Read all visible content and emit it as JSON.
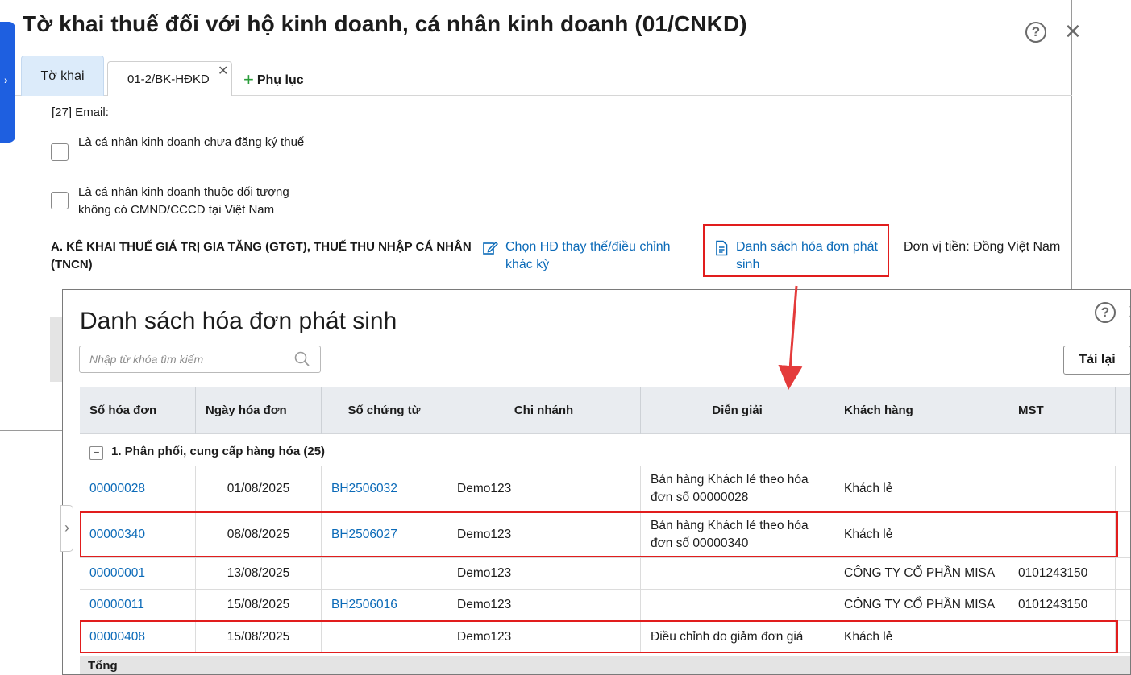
{
  "background_window": {
    "title": "Tờ khai thuế đối với hộ kinh doanh, cá nhân kinh doanh (01/CNKD)",
    "help_icon": "?",
    "close_icon": "✕",
    "tabs": [
      {
        "label": "Tờ khai",
        "active": true
      },
      {
        "label": "01-2/BK-HĐKD",
        "closable": true
      }
    ],
    "add_tab_label": "Phụ lục",
    "email_label": "[27] Email:",
    "checkboxes": [
      {
        "label": "Là cá nhân kinh doanh chưa đăng ký thuế",
        "checked": false
      },
      {
        "label": "Là cá nhân kinh doanh thuộc đối tượng không có CMND/CCCD tại Việt Nam",
        "checked": false
      }
    ],
    "section_a_title": "A. KÊ KHAI THUẾ GIÁ TRỊ GIA TĂNG (GTGT), THUẾ THU NHẬP CÁ NHÂN (TNCN)",
    "link_choose": "Chọn HĐ thay thế/điều chỉnh khác kỳ",
    "link_invoice_list": "Danh sách hóa đơn phát sinh",
    "currency_unit": "Đơn vị tiền: Đồng Việt Nam"
  },
  "dialog": {
    "title": "Danh sách hóa đơn phát sinh",
    "search_placeholder": "Nhập từ khóa tìm kiếm",
    "reload_button": "Tải lại",
    "columns": [
      "Số hóa đơn",
      "Ngày hóa đơn",
      "Số chứng từ",
      "Chi nhánh",
      "Diễn giải",
      "Khách hàng",
      "MST"
    ],
    "group": {
      "label": "1. Phân phối, cung cấp hàng hóa (25)",
      "expanded": true
    },
    "rows": [
      {
        "invoice_no": "00000028",
        "date": "01/08/2025",
        "voucher_no": "BH2506032",
        "branch": "Demo123",
        "description": "Bán hàng Khách lẻ theo hóa đơn số 00000028",
        "customer": "Khách lẻ",
        "tax_code": "",
        "highlighted": false
      },
      {
        "invoice_no": "00000340",
        "date": "08/08/2025",
        "voucher_no": "BH2506027",
        "branch": "Demo123",
        "description": "Bán hàng Khách lẻ theo hóa đơn số 00000340",
        "customer": "Khách lẻ",
        "tax_code": "",
        "highlighted": true
      },
      {
        "invoice_no": "00000001",
        "date": "13/08/2025",
        "voucher_no": "",
        "branch": "Demo123",
        "description": "",
        "customer": "CÔNG TY CỔ PHẦN MISA",
        "tax_code": "0101243150",
        "highlighted": false
      },
      {
        "invoice_no": "00000011",
        "date": "15/08/2025",
        "voucher_no": "BH2506016",
        "branch": "Demo123",
        "description": "",
        "customer": "CÔNG TY CỔ PHẦN MISA",
        "tax_code": "0101243150",
        "highlighted": false
      },
      {
        "invoice_no": "00000408",
        "date": "15/08/2025",
        "voucher_no": "",
        "branch": "Demo123",
        "description": "Điều chỉnh do giảm đơn giá",
        "customer": "Khách lẻ",
        "tax_code": "",
        "highlighted": true
      }
    ],
    "total_label": "Tổng"
  },
  "colors": {
    "accent_blue": "#1e5fe0",
    "link_blue": "#0b6ab8",
    "highlight_red": "#e11d1d",
    "add_green": "#2a9d3a"
  }
}
